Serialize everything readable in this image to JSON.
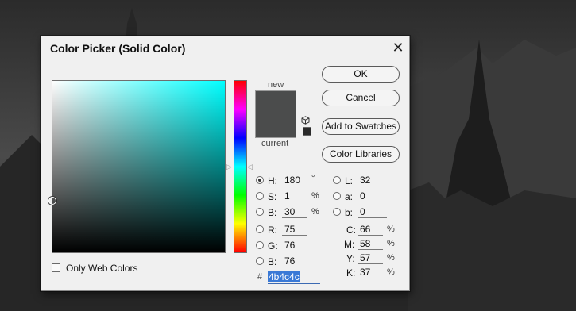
{
  "dialog": {
    "title": "Color Picker (Solid Color)",
    "close_glyph": "✕"
  },
  "preview": {
    "new_label": "new",
    "current_label": "current",
    "new_color": "#4b4c4c",
    "field_hue_color": "#00ffff",
    "gamut_icon": "cube-icon"
  },
  "buttons": {
    "ok": "OK",
    "cancel": "Cancel",
    "add_to_swatches": "Add to Swatches",
    "color_libraries": "Color Libraries"
  },
  "hsb": {
    "h": {
      "label": "H:",
      "value": "180",
      "unit": "°",
      "selected": true
    },
    "s": {
      "label": "S:",
      "value": "1",
      "unit": "%"
    },
    "b": {
      "label": "B:",
      "value": "30",
      "unit": "%"
    }
  },
  "rgb": {
    "r": {
      "label": "R:",
      "value": "75"
    },
    "g": {
      "label": "G:",
      "value": "76"
    },
    "b": {
      "label": "B:",
      "value": "76"
    }
  },
  "lab": {
    "l": {
      "label": "L:",
      "value": "32"
    },
    "a": {
      "label": "a:",
      "value": "0"
    },
    "b": {
      "label": "b:",
      "value": "0"
    }
  },
  "cmyk": {
    "c": {
      "label": "C:",
      "value": "66",
      "unit": "%"
    },
    "m": {
      "label": "M:",
      "value": "58",
      "unit": "%"
    },
    "y": {
      "label": "Y:",
      "value": "57",
      "unit": "%"
    },
    "k": {
      "label": "K:",
      "value": "37",
      "unit": "%"
    }
  },
  "hex": {
    "label": "#",
    "value": "4b4c4c"
  },
  "options": {
    "only_web_colors": "Only Web Colors"
  }
}
